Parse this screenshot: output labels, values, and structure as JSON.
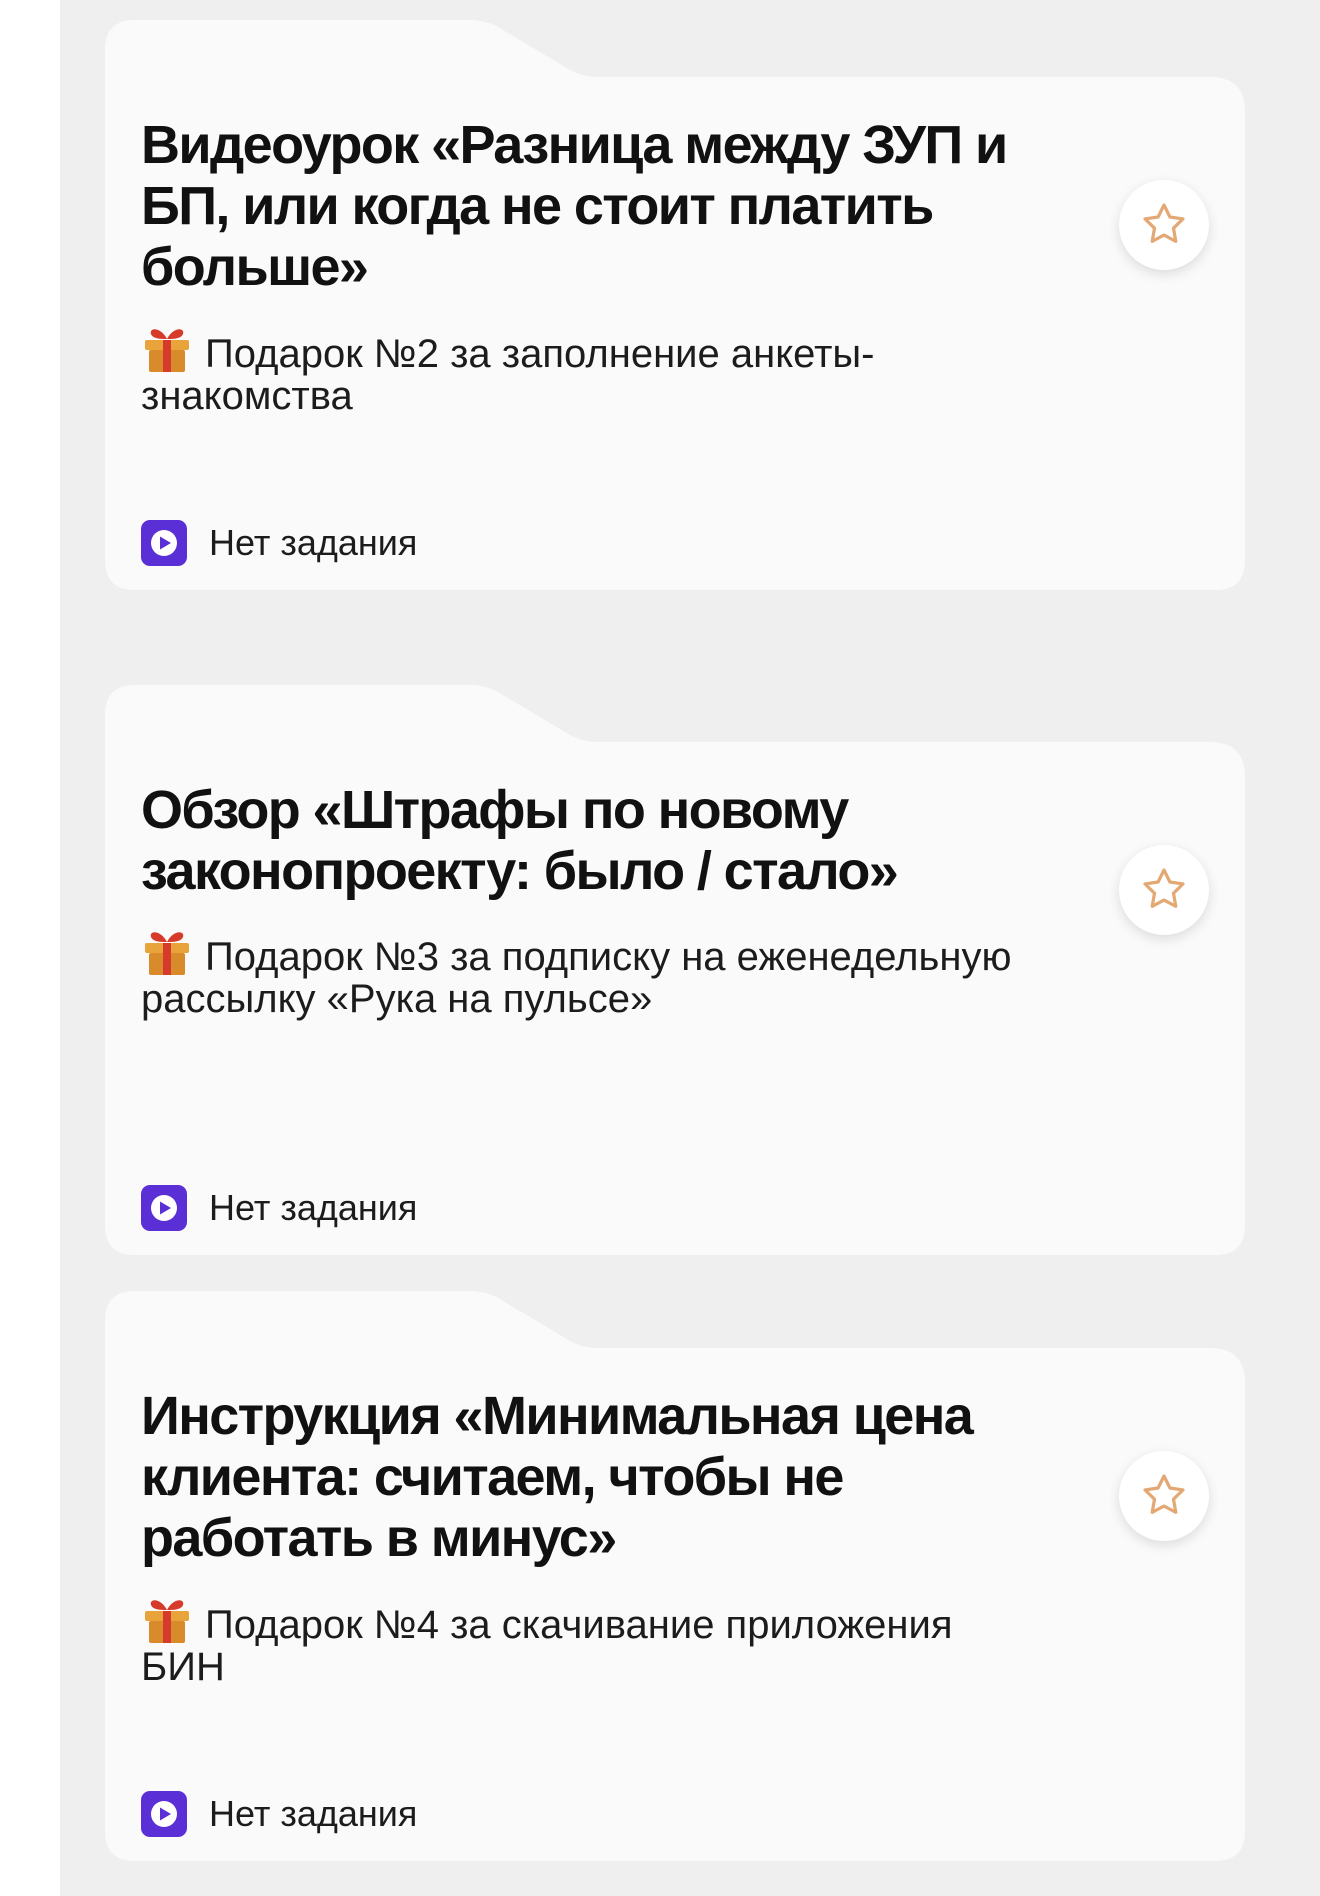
{
  "cards": [
    {
      "title": "Видеоурок «Разница между ЗУП и БП, или когда не стоит платить больше»",
      "subtitle": "Подарок №2 за заполнение анкеты-знакомства",
      "status": "Нет задания"
    },
    {
      "title": "Обзор «Штрафы по новому законопроекту: было / стало»",
      "subtitle": "Подарок №3 за подписку на еженедельную рассылку «Рука на пульсе»",
      "status": "Нет задания"
    },
    {
      "title": "Инструкция «Минимальная цена клиента: считаем, чтобы не работать в минус»",
      "subtitle": "Подарок №4 за скачивание приложения БИН",
      "status": "Нет задания"
    }
  ],
  "icons": {
    "gift": "gift-icon",
    "play": "play-icon",
    "favorite": "star-icon"
  },
  "colors": {
    "background": "#efefef",
    "card": "#fafafa",
    "accent_play": "#5a2fd6",
    "star_outline": "#e3a874"
  }
}
